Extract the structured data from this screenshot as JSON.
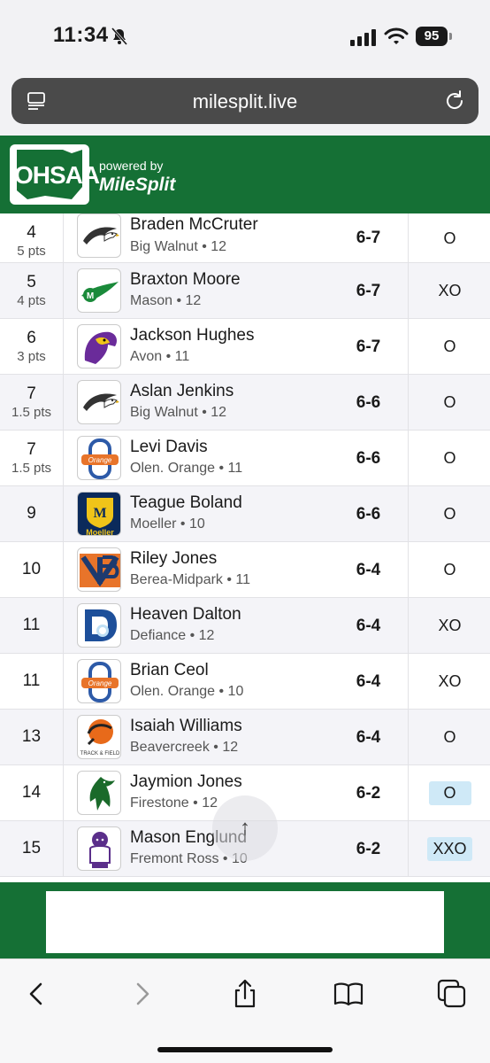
{
  "status": {
    "time": "11:34",
    "battery": "95"
  },
  "browser": {
    "url": "milesplit.live"
  },
  "header": {
    "logo_text": "OHSAA",
    "powered_by": "powered by",
    "brand": "MileSplit"
  },
  "results": [
    {
      "place": "4",
      "points": "5 pts",
      "name": "Braden McCruter",
      "school": "Big Walnut • 12",
      "mark": "6-7",
      "attempt": "O",
      "highlight": false,
      "logo": "eagle"
    },
    {
      "place": "5",
      "points": "4 pts",
      "name": "Braxton Moore",
      "school": "Mason • 12",
      "mark": "6-7",
      "attempt": "XO",
      "highlight": false,
      "logo": "mason"
    },
    {
      "place": "6",
      "points": "3 pts",
      "name": "Jackson Hughes",
      "school": "Avon • 11",
      "mark": "6-7",
      "attempt": "O",
      "highlight": false,
      "logo": "avon"
    },
    {
      "place": "7",
      "points": "1.5 pts",
      "name": "Aslan Jenkins",
      "school": "Big Walnut • 12",
      "mark": "6-6",
      "attempt": "O",
      "highlight": false,
      "logo": "eagle"
    },
    {
      "place": "7",
      "points": "1.5 pts",
      "name": "Levi Davis",
      "school": "Olen. Orange • 11",
      "mark": "6-6",
      "attempt": "O",
      "highlight": false,
      "logo": "orange"
    },
    {
      "place": "9",
      "points": "",
      "name": "Teague Boland",
      "school": "Moeller • 10",
      "mark": "6-6",
      "attempt": "O",
      "highlight": false,
      "logo": "moeller"
    },
    {
      "place": "10",
      "points": "",
      "name": "Riley Jones",
      "school": "Berea-Midpark • 11",
      "mark": "6-4",
      "attempt": "O",
      "highlight": false,
      "logo": "berea"
    },
    {
      "place": "11",
      "points": "",
      "name": "Heaven Dalton",
      "school": "Defiance • 12",
      "mark": "6-4",
      "attempt": "XO",
      "highlight": false,
      "logo": "defiance"
    },
    {
      "place": "11",
      "points": "",
      "name": "Brian Ceol",
      "school": "Olen. Orange • 10",
      "mark": "6-4",
      "attempt": "XO",
      "highlight": false,
      "logo": "orange"
    },
    {
      "place": "13",
      "points": "",
      "name": "Isaiah Williams",
      "school": "Beavercreek • 12",
      "mark": "6-4",
      "attempt": "O",
      "highlight": false,
      "logo": "beavercreek"
    },
    {
      "place": "14",
      "points": "",
      "name": "Jaymion Jones",
      "school": "Firestone • 12",
      "mark": "6-2",
      "attempt": "O",
      "highlight": true,
      "logo": "firestone"
    },
    {
      "place": "15",
      "points": "",
      "name": "Mason Englund",
      "school": "Fremont Ross • 10",
      "mark": "6-2",
      "attempt": "XXO",
      "highlight": true,
      "logo": "fremont"
    }
  ],
  "scroll_top": {
    "icon": "arrow-up-icon",
    "glyph": "↑"
  },
  "colors": {
    "brand_green": "#157035",
    "highlight": "#cfe9f7"
  }
}
